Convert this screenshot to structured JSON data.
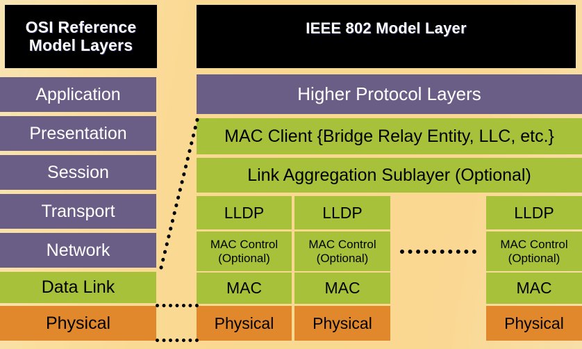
{
  "colors": {
    "background_start": "#f7e4b4",
    "background_mid": "#fad894",
    "header_bg": "#000000",
    "header_text": "#ffffff",
    "purple": "#6b5e86",
    "green": "#a7c13a",
    "orange": "#e0882b",
    "dot_color": "#000000"
  },
  "osi": {
    "header": "OSI Reference\nModel Layers",
    "header_line1": "OSI Reference",
    "header_line2": "Model Layers",
    "layers": [
      {
        "label": "Application",
        "color": "purple"
      },
      {
        "label": "Presentation",
        "color": "purple"
      },
      {
        "label": "Session",
        "color": "purple"
      },
      {
        "label": "Transport",
        "color": "purple"
      },
      {
        "label": "Network",
        "color": "purple"
      },
      {
        "label": "Data Link",
        "color": "green"
      },
      {
        "label": "Physical",
        "color": "orange"
      }
    ]
  },
  "ieee": {
    "header": "IEEE 802 Model Layer",
    "wide_rows": [
      {
        "label": "Higher Protocol Layers",
        "color": "purple"
      },
      {
        "label": "MAC Client {Bridge Relay Entity, LLC, etc.}",
        "color": "green"
      },
      {
        "label": "Link Aggregation  Sublayer (Optional)",
        "color": "green"
      }
    ],
    "stack_rows": [
      "LLDP",
      "MAC Control (Optional)",
      "MAC",
      "Physical"
    ],
    "columns": [
      {
        "lldp": "LLDP",
        "mac_control_line1": "MAC Control",
        "mac_control_line2": "(Optional)",
        "mac": "MAC",
        "physical": "Physical"
      },
      {
        "lldp": "LLDP",
        "mac_control_line1": "MAC Control",
        "mac_control_line2": "(Optional)",
        "mac": "MAC",
        "physical": "Physical"
      },
      {
        "lldp": "LLDP",
        "mac_control_line1": "MAC Control",
        "mac_control_line2": "(Optional)",
        "mac": "MAC",
        "physical": "Physical"
      }
    ],
    "ellipsis": "..............."
  }
}
